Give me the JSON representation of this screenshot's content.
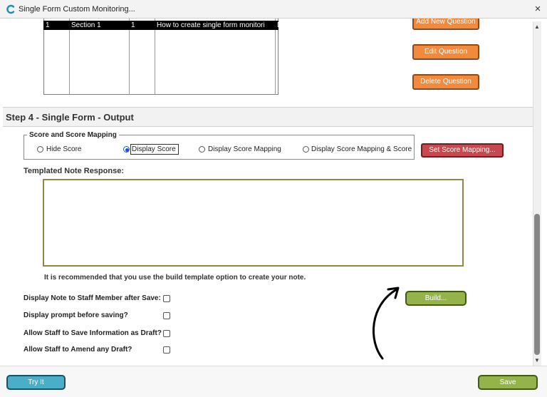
{
  "window": {
    "title": "Single Form Custom Monitoring...",
    "close_glyph": "×",
    "icon": "c-logo-icon"
  },
  "table": {
    "row": [
      "1",
      "Section 1",
      "1",
      "How to create single form monitori",
      "Drop Down Select"
    ]
  },
  "buttons": {
    "add_question": "Add New Question",
    "edit_question": "Edit Question",
    "delete_question": "Delete Question",
    "set_score_mapping": "Set Score Mapping...",
    "build": "Build...",
    "try_it": "Try It",
    "save": "Save"
  },
  "step4": {
    "title": "Step 4 - Single Form - Output"
  },
  "score_group": {
    "legend": "Score and Score Mapping",
    "options": [
      "Hide Score",
      "Display Score",
      "Display Score Mapping",
      "Display Score Mapping & Score"
    ],
    "selected": "Display Score"
  },
  "templated_note": {
    "label": "Templated Note Response:",
    "value": "",
    "hint": "It is recommended that you use the build template option to create your note."
  },
  "options": [
    "Display Note to Staff Member after Save:",
    "Display prompt before saving?",
    "Allow Staff to Save Information as Draft?",
    "Allow Staff to Amend any  Draft?"
  ],
  "colors": {
    "orange": "#f28a3d",
    "red": "#c9474d",
    "green": "#94b34a",
    "blue": "#4aaec9",
    "textarea_border": "#8f8748"
  }
}
